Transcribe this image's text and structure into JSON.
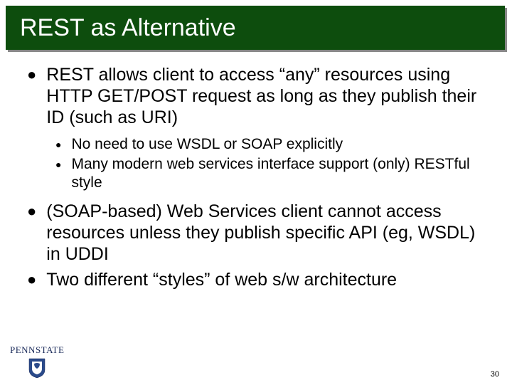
{
  "slide": {
    "title": "REST as Alternative",
    "bullets": [
      {
        "text": "REST allows client to access “any” resources using HTTP GET/POST request as long as they publish their ID (such as URI)",
        "sub": [
          "No need to use WSDL or SOAP explicitly",
          "Many modern web services interface support (only) RESTful style"
        ]
      },
      {
        "text": "(SOAP-based) Web Services client cannot access resources unless they publish specific API (eg, WSDL) in UDDI",
        "sub": []
      },
      {
        "text": "Two different “styles” of web s/w architecture",
        "sub": []
      }
    ]
  },
  "footer": {
    "logo_text": "PENNSTATE",
    "page_number": "30"
  },
  "colors": {
    "title_bg": "#0d4d0d",
    "shield_blue": "#2a4a8a"
  }
}
